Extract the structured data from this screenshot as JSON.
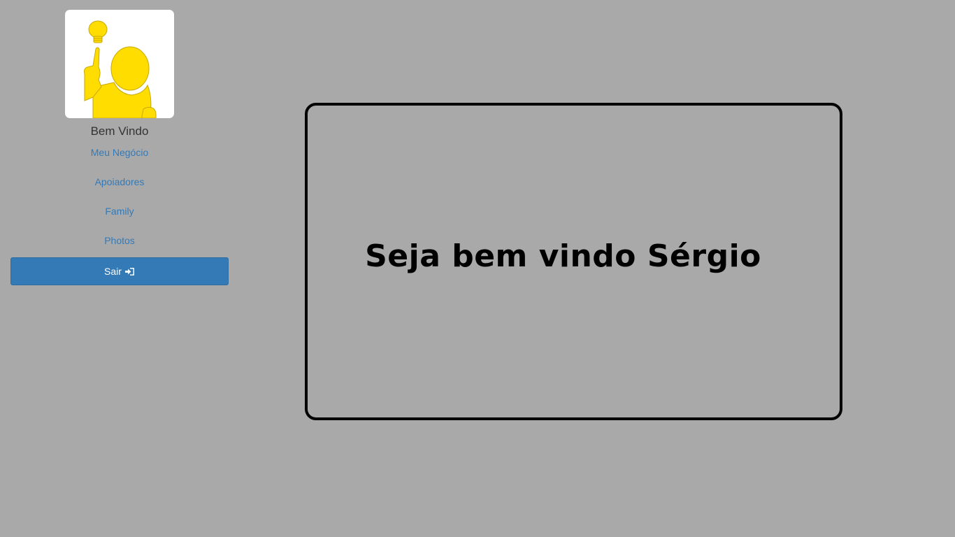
{
  "sidebar": {
    "avatar_alt": "idea person",
    "welcome_label": "Bem Vindo",
    "nav_items": [
      {
        "label": "Meu Negócio"
      },
      {
        "label": "Apoiadores"
      },
      {
        "label": "Family"
      },
      {
        "label": "Photos"
      }
    ],
    "logout": {
      "label": "Sair",
      "icon": "sign-in-icon"
    }
  },
  "main": {
    "message": "Seja bem vindo Sérgio"
  },
  "colors": {
    "background": "#a9a9a9",
    "link": "#337ab7",
    "button": "#337ab7",
    "avatar_figure": "#ffdd00"
  }
}
